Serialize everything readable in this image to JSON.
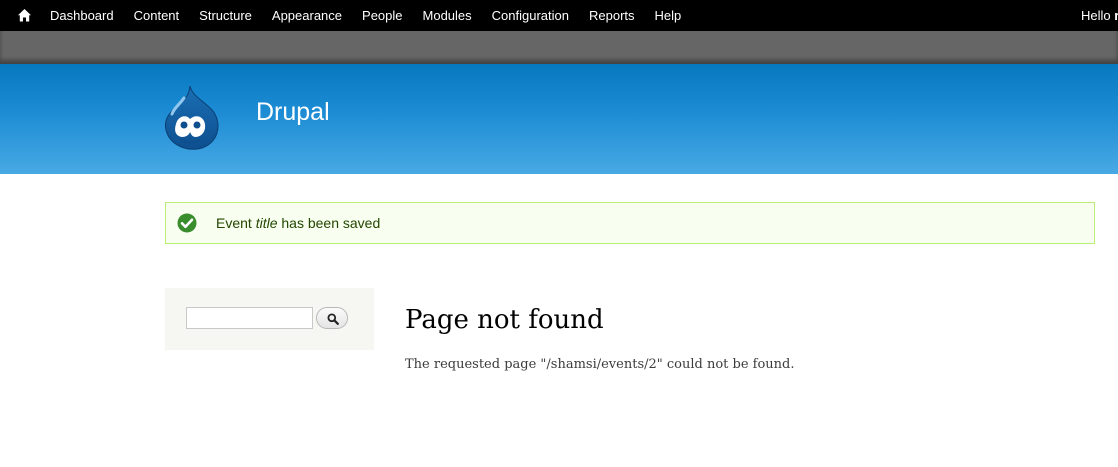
{
  "toolbar": {
    "menu": [
      "Dashboard",
      "Content",
      "Structure",
      "Appearance",
      "People",
      "Modules",
      "Configuration",
      "Reports",
      "Help"
    ],
    "hello_prefix": "Hello ",
    "hello_user": "r"
  },
  "header": {
    "site_name": "Drupal"
  },
  "status": {
    "prefix": "Event ",
    "title": "title",
    "suffix": " has been saved"
  },
  "search": {
    "value": ""
  },
  "main": {
    "title": "Page not found",
    "message": "The requested page \"/shamsi/events/2\" could not be found."
  },
  "colors": {
    "toolbar": "#000000",
    "shortcut_bar": "#666666",
    "header_top": "#0779bf",
    "header_bottom": "#48a9e4",
    "status_border": "#bbee77",
    "status_text": "#234600",
    "check_green": "#3a8d2d"
  },
  "icons": {
    "home": "home-icon",
    "logo": "drupal-drop-logo",
    "status": "check-circle-icon",
    "search": "magnifier-icon"
  }
}
